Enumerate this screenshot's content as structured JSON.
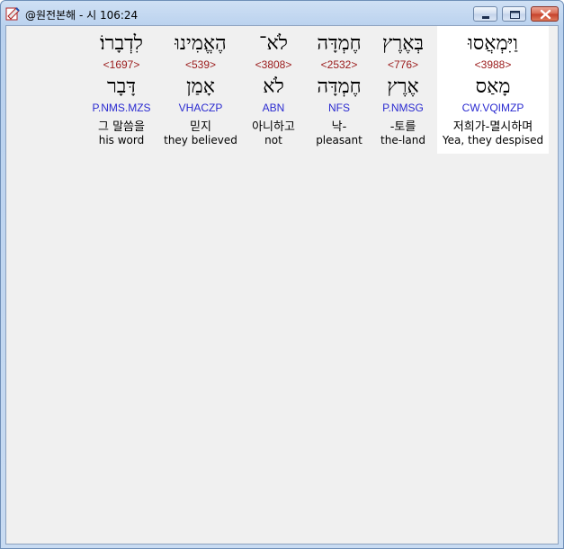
{
  "window": {
    "title": "@원전본해 - 시 106:24"
  },
  "words": [
    {
      "hebrew": "וַיִּמְאֲסוּ",
      "strong": "<3988>",
      "root": "מָאַס",
      "parse": "CW.VQIMZP",
      "korean": "저희가-멸시하며",
      "english": "Yea, they despised"
    },
    {
      "hebrew": "בְּאֶרֶץ",
      "strong": "<776>",
      "root": "אֶרֶץ",
      "parse": "P.NMSG",
      "korean": "-토를",
      "english": "the-land"
    },
    {
      "hebrew": "חֶמְדָּה",
      "strong": "<2532>",
      "root": "חֶמְדָּה",
      "parse": "NFS",
      "korean": "낙-",
      "english": "pleasant"
    },
    {
      "hebrew": "לֹא־",
      "strong": "<3808>",
      "root": "לֹא",
      "parse": "ABN",
      "korean": "아니하고",
      "english": "not"
    },
    {
      "hebrew": "הֶאֱמִינוּ",
      "strong": "<539>",
      "root": "אָמַן",
      "parse": "VHACZP",
      "korean": "믿지",
      "english": "they believed"
    },
    {
      "hebrew": "לִדְבָרוֹ׃",
      "strong": "<1697>",
      "root": "דָּבָר",
      "parse": "P.NMS.MZS",
      "korean": "그 말씀을",
      "english": "his word"
    }
  ]
}
